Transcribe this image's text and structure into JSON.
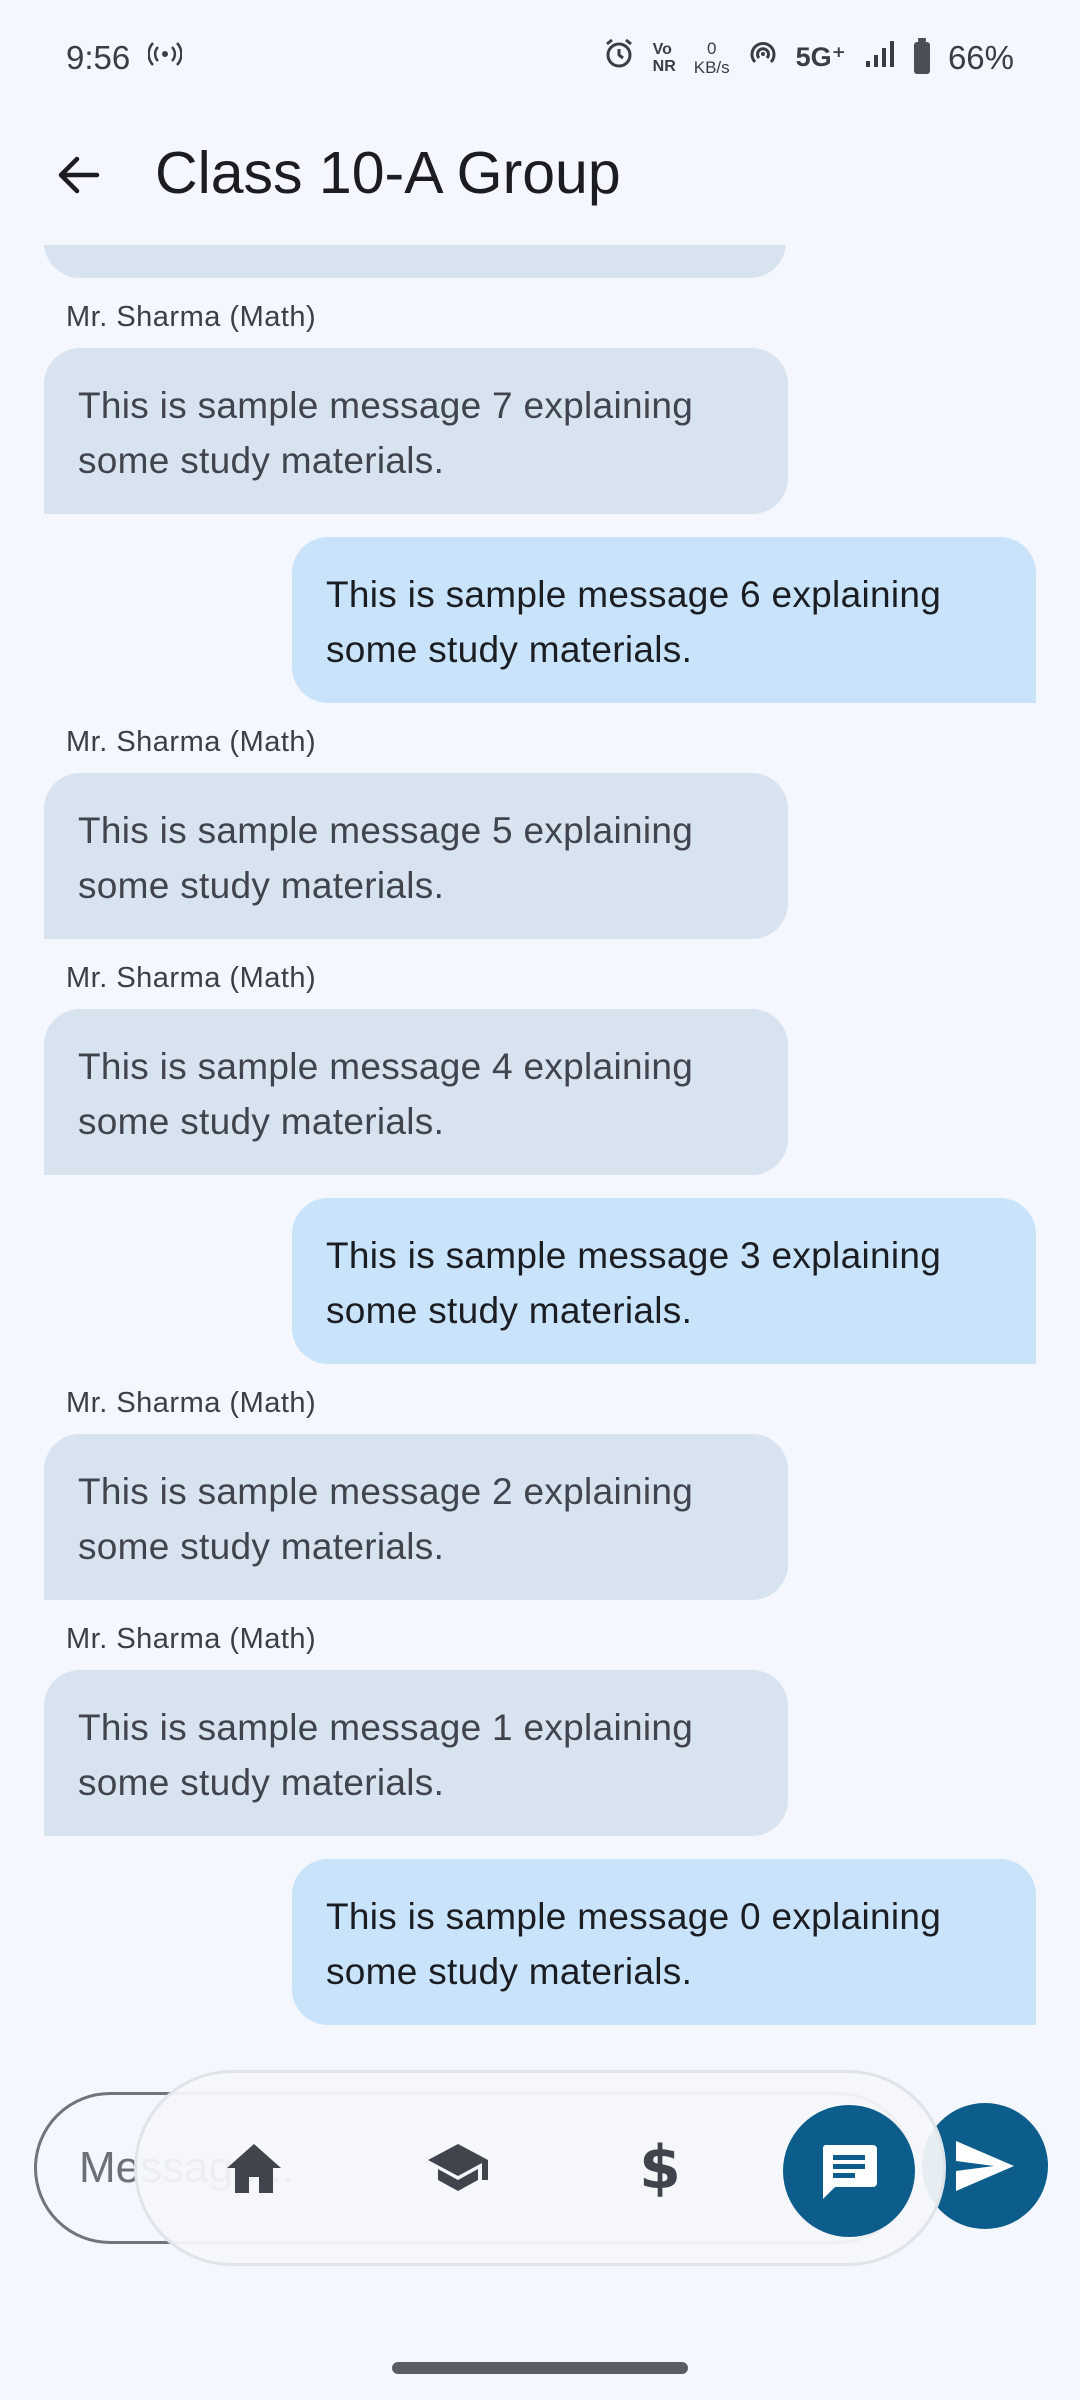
{
  "status_bar": {
    "time": "9:56",
    "volte_top": "Vo",
    "volte_bottom": "NR",
    "net_speed_value": "0",
    "net_speed_unit": "KB/s",
    "network": "5G⁺",
    "battery": "66%"
  },
  "header": {
    "title": "Class 10-A Group"
  },
  "messages": [
    {
      "sender": "Mr. Sharma (Math)",
      "text": "This is sample message 7 explaining some study materials.",
      "direction": "incoming"
    },
    {
      "sender": "",
      "text": "This is sample message 6 explaining some study materials.",
      "direction": "outgoing"
    },
    {
      "sender": "Mr. Sharma (Math)",
      "text": "This is sample message 5 explaining some study materials.",
      "direction": "incoming"
    },
    {
      "sender": "Mr. Sharma (Math)",
      "text": "This is sample message 4 explaining some study materials.",
      "direction": "incoming"
    },
    {
      "sender": "",
      "text": "This is sample message 3 explaining some study materials.",
      "direction": "outgoing"
    },
    {
      "sender": "Mr. Sharma (Math)",
      "text": "This is sample message 2 explaining some study materials.",
      "direction": "incoming"
    },
    {
      "sender": "Mr. Sharma (Math)",
      "text": "This is sample message 1 explaining some study materials.",
      "direction": "incoming"
    },
    {
      "sender": "",
      "text": "This is sample message 0 explaining some study materials.",
      "direction": "outgoing"
    }
  ],
  "composer": {
    "placeholder": "Message..."
  },
  "bottom_nav": {
    "items": [
      {
        "icon": "home-icon",
        "active": false
      },
      {
        "icon": "school-icon",
        "active": false
      },
      {
        "icon": "dollar-icon",
        "glyph": "$",
        "active": false
      },
      {
        "icon": "chat-icon",
        "active": true
      }
    ]
  },
  "colors": {
    "background": "#f4f7fd",
    "incoming_bubble": "#d8e3f0",
    "outgoing_bubble": "#c8e3fa",
    "accent": "#0c5d8c"
  }
}
